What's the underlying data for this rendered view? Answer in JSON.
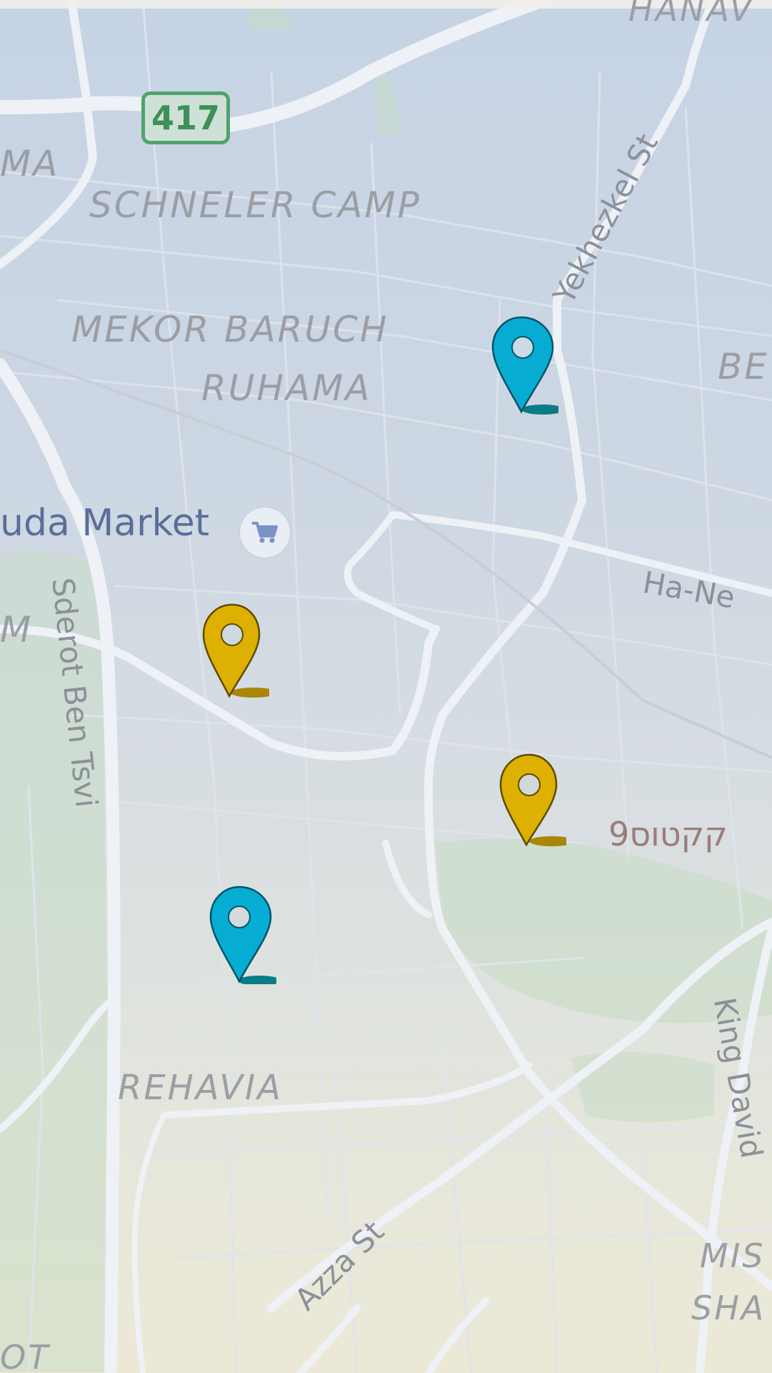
{
  "map": {
    "labels": {
      "hanaviim": "HANAV",
      "ma": "MA",
      "schneler_camp": "SCHNELER CAMP",
      "mekor_baruch": "MEKOR BARUCH",
      "ruhama": "RUHAMA",
      "be": "BE",
      "market": "uda Market",
      "m": "M",
      "ha_nevi": "Ha-Ne",
      "yekhezkel": "Yekhezkel St",
      "sderot_ben_tsvi": "Sderot Ben Tsvi",
      "hebrew_poi": "קקטוס9",
      "rehavia": "REHAVIA",
      "azza": "Azza St",
      "king_david": "King David",
      "mis": "MIS",
      "sha": "SHA",
      "ot": "OT"
    },
    "route_shield": "417",
    "icons": {
      "market": "shopping-cart-icon",
      "pins": [
        "map-pin-icon",
        "map-pin-icon",
        "map-pin-icon",
        "map-pin-icon"
      ]
    },
    "colors": {
      "pin_blue": "#07acd3",
      "pin_blue_shadow": "#0a7c86",
      "pin_gold": "#ddb001",
      "pin_gold_shadow": "#a98604",
      "road": "#eef1f5",
      "district_text": "#9b9ea4",
      "park": "#bfd8c0",
      "shield": "#4fa46a"
    }
  }
}
